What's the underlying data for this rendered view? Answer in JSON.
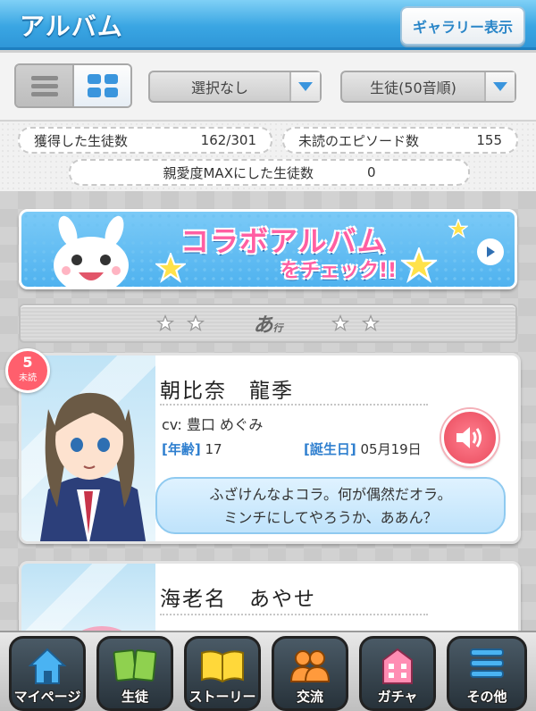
{
  "header": {
    "title": "アルバム",
    "gallery_button": "ギャラリー表示"
  },
  "toolbar": {
    "view_modes": [
      "list-icon",
      "grid-icon"
    ],
    "active_view": "grid",
    "filter_select": "選択なし",
    "sort_select": "生徒(50音順)"
  },
  "stats": {
    "acquired_label": "獲得した生徒数",
    "acquired_value": "162/301",
    "unread_label": "未読のエピソード数",
    "unread_value": "155",
    "max_affection_label": "親愛度MAXにした生徒数",
    "max_affection_value": "0"
  },
  "banner": {
    "title": "コラボアルバム",
    "subtitle": "をチェック!!"
  },
  "section": {
    "label": "あ",
    "suffix": "行"
  },
  "cards": [
    {
      "name": "朝比奈　龍季",
      "cv": "cv: 豊口 めぐみ",
      "age_key": "[年齢]",
      "age_value": "17",
      "birthday_key": "[誕生日]",
      "birthday_value": "05月19日",
      "quote_line1": "ふざけんなよコラ。何が偶然だオラ。",
      "quote_line2": "ミンチにしてやろうか、ああん？",
      "unread_count": "5",
      "unread_label": "未読"
    },
    {
      "name": "海老名　あやせ"
    }
  ],
  "bottom_nav": [
    {
      "label": "マイページ",
      "icon": "home-icon"
    },
    {
      "label": "生徒",
      "icon": "cards-icon"
    },
    {
      "label": "ストーリー",
      "icon": "book-icon"
    },
    {
      "label": "交流",
      "icon": "people-icon"
    },
    {
      "label": "ガチャ",
      "icon": "building-icon"
    },
    {
      "label": "その他",
      "icon": "menu-icon"
    }
  ],
  "colors": {
    "header_blue": "#3aa6e3",
    "accent_pink": "#ff5fa2",
    "badge_red": "#ff5f6d",
    "link_blue": "#2f7fcf"
  }
}
